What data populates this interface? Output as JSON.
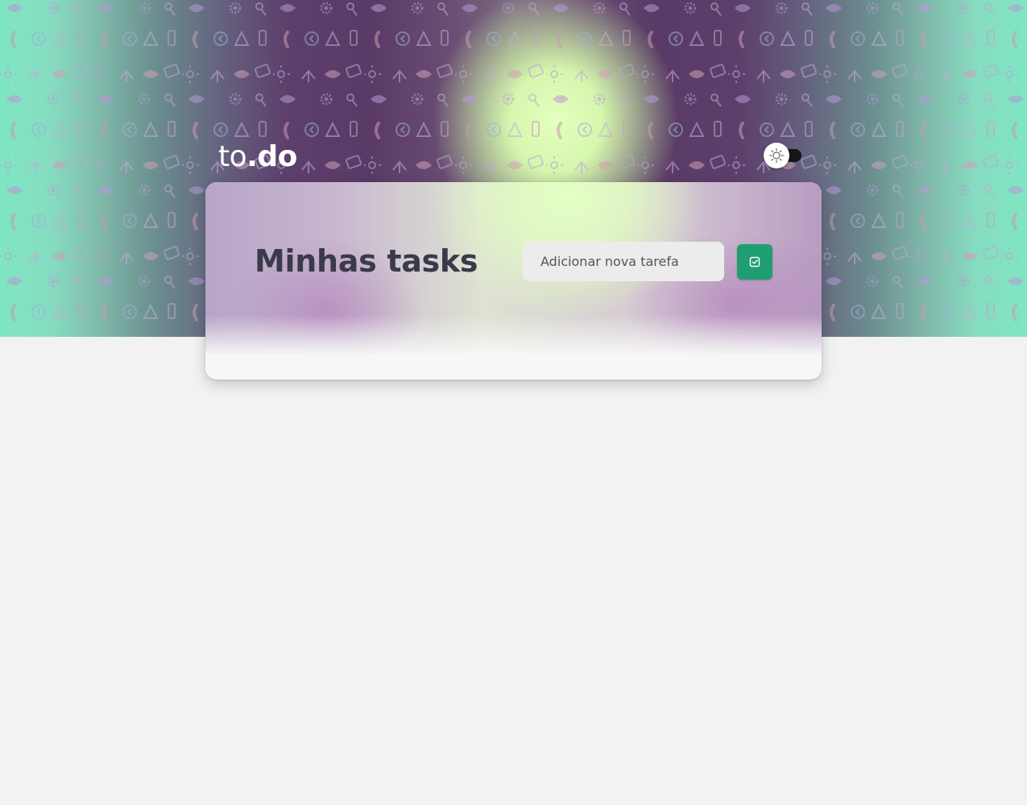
{
  "header": {
    "brand_prefix": "to",
    "brand_dot": ".",
    "brand_suffix": "do",
    "theme_toggle": {
      "icon": "sun-icon",
      "state": "light"
    }
  },
  "card": {
    "title": "Minhas tasks",
    "new_task_input": {
      "placeholder": "Adicionar nova tarefa",
      "value": ""
    },
    "add_button": {
      "icon": "check-square-icon"
    }
  },
  "colors": {
    "accent": "#1e9e72",
    "page_background": "#f2f2f2",
    "title_text": "#3b3a4a",
    "hero_edge": "#7fe6c3",
    "hero_center": "#5a3a66",
    "hero_glow": "#e4ffbf"
  }
}
